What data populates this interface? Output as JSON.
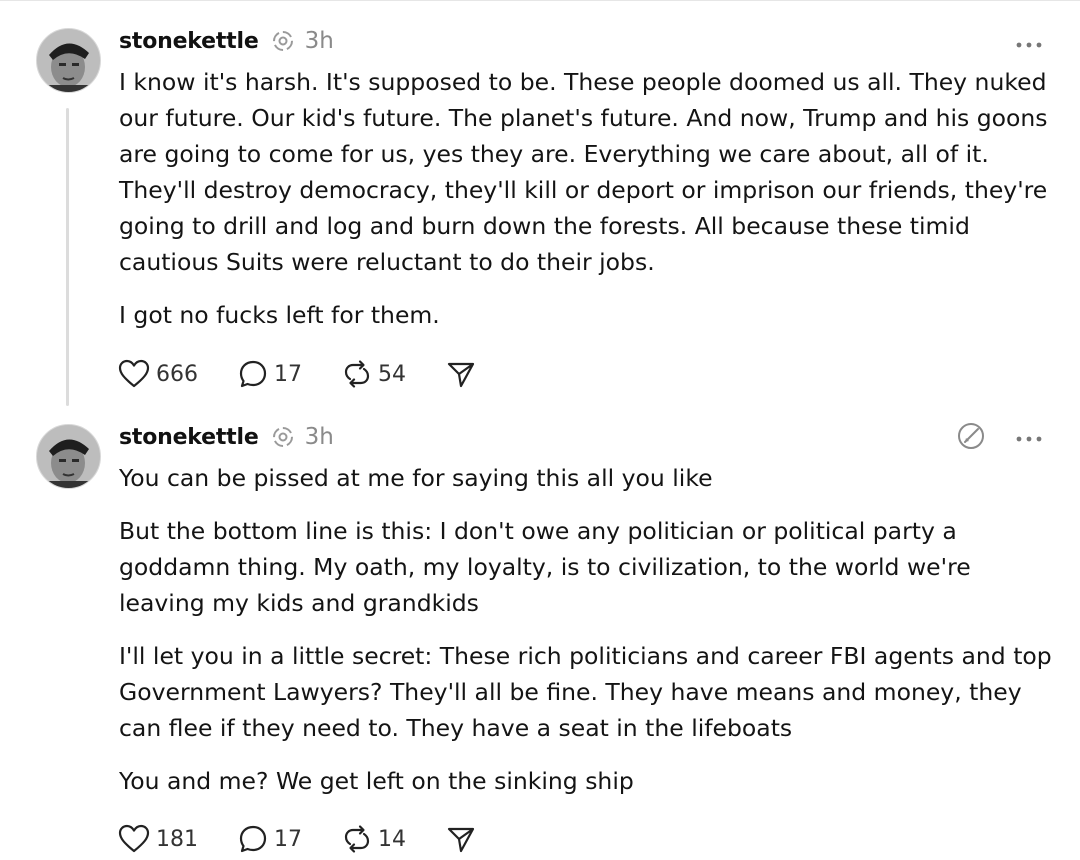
{
  "posts": [
    {
      "username": "stonekettle",
      "time": "3h",
      "paragraphs": [
        "I know it's harsh. It's supposed to be. These people doomed us all. They nuked our future. Our kid's future. The planet's future. And now, Trump and his goons are going to come for us, yes they are. Everything we care about, all of it. They'll destroy democracy, they'll kill or deport or imprison our friends, they're going to drill and log and burn down the forests. All because these timid cautious Suits were reluctant to do their jobs.",
        "I got no fucks left for them."
      ],
      "likes": "666",
      "replies": "17",
      "reposts": "54"
    },
    {
      "username": "stonekettle",
      "time": "3h",
      "paragraphs": [
        "You can be pissed at me for saying this all you like",
        "But the bottom line is this: I don't owe any politician or political party a goddamn thing. My oath, my loyalty, is to civilization, to the world we're leaving my kids and grandkids",
        "I'll let you in a little secret: These rich politicians and career FBI agents and top Government Lawyers? They'll all be fine. They have means and money, they can flee if they need to. They have a seat in the lifeboats",
        "You and me? We get left on the sinking ship"
      ],
      "likes": "181",
      "replies": "17",
      "reposts": "14"
    }
  ],
  "icons": {
    "like": "heart-icon",
    "reply": "comment-icon",
    "repost": "repost-icon",
    "share": "send-icon",
    "more": "more-options-icon",
    "edit": "edit-icon",
    "cross_post": "sync-icon"
  },
  "colors": {
    "text": "#111111",
    "muted": "#8a8a8a",
    "thread_line": "#dcdcdc",
    "background": "#ffffff"
  }
}
